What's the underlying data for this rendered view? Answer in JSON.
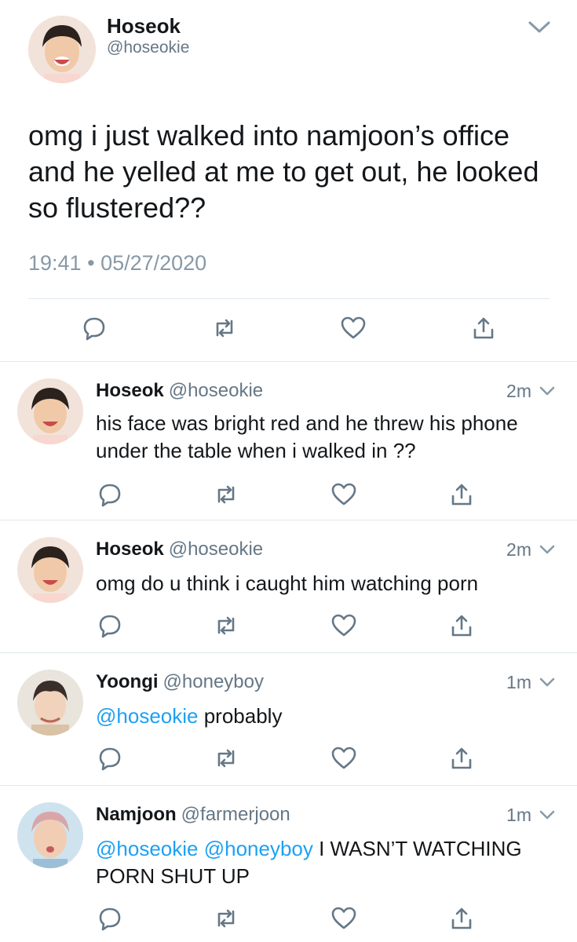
{
  "main_tweet": {
    "name": "Hoseok",
    "handle": "@hoseokie",
    "text": "omg i just walked into namjoon’s office and he yelled at me to get out, he looked so flustered??",
    "time": "19:41",
    "separator": "•",
    "date": "05/27/2020",
    "avatar": "avatar-hoseok"
  },
  "replies": [
    {
      "name": "Hoseok",
      "handle": "@hoseokie",
      "time": "2m",
      "mentions": [],
      "text": "his face was bright red and he threw his phone under the table when i walked in ??"
    },
    {
      "name": "Hoseok",
      "handle": "@hoseokie",
      "time": "2m",
      "mentions": [],
      "text": "omg do u think i caught him watching porn"
    },
    {
      "name": "Yoongi",
      "handle": "@honeyboy",
      "time": "1m",
      "mentions": [
        "@hoseokie"
      ],
      "text": "probably"
    },
    {
      "name": "Namjoon",
      "handle": "@farmerjoon",
      "time": "1m",
      "mentions": [
        "@hoseokie",
        "@honeyboy"
      ],
      "text": "I WASN’T WATCHING PORN SHUT UP"
    }
  ],
  "icons": [
    "reply-icon",
    "retweet-icon",
    "like-icon",
    "share-icon",
    "chevron-down-icon"
  ],
  "colors": {
    "text": "#14171a",
    "secondary": "#657786",
    "mention": "#1da1f2",
    "icon": "#657786",
    "divider": "#e1e8ed"
  }
}
